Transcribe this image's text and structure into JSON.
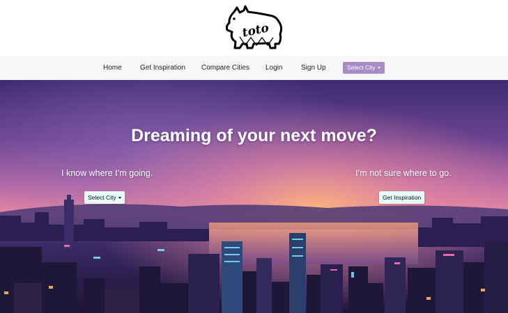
{
  "brand": {
    "logo_text": "toto",
    "logo_icon": "scottie-dog-icon"
  },
  "nav": {
    "links": [
      "Home",
      "Get Inspiration",
      "Compare Cities",
      "Login",
      "Sign Up"
    ],
    "city_dropdown": "Select City",
    "dropdown_color": "#a98cc6"
  },
  "hero": {
    "title": "Dreaming of your next move?",
    "left_text": "I know where I’m going.",
    "left_button": "Select City",
    "right_text": "I’m not sure where to go.",
    "right_button": "Get Inspiration"
  },
  "colors": {
    "hero_sky_top": "#3a2a6e",
    "hero_sky_mid": "#c26aa2",
    "hero_glow": "#f7a067",
    "button_bg": "#e9fbf8"
  }
}
